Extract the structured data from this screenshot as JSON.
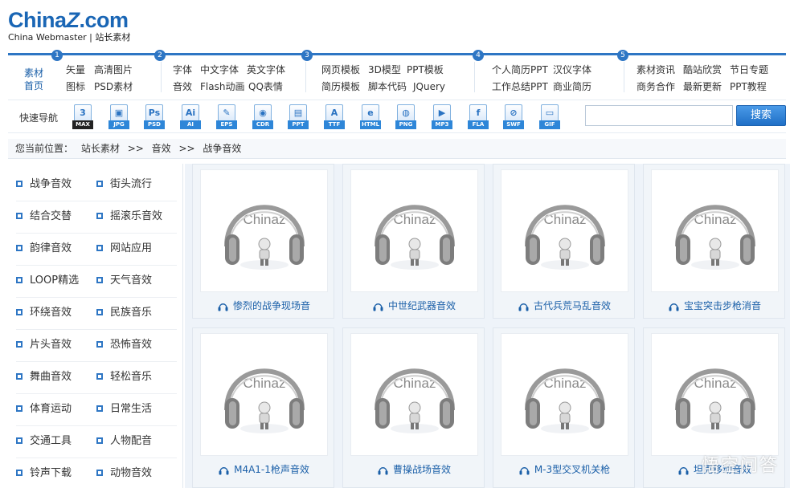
{
  "logo": {
    "main_a": "China",
    "main_z": "Z",
    "main_b": ".com",
    "sub": "China Webmaster | 站长素材"
  },
  "catnav": {
    "home": [
      "素材",
      "首页"
    ],
    "sections": [
      {
        "num": "1",
        "links": [
          "矢量",
          "高清图片",
          "图标",
          "PSD素材"
        ]
      },
      {
        "num": "2",
        "links": [
          "字体",
          "中文字体",
          "英文字体",
          "音效",
          "Flash动画",
          "QQ表情"
        ]
      },
      {
        "num": "3",
        "links": [
          "网页模板",
          "3D模型",
          "PPT模板",
          "简历模板",
          "脚本代码",
          "JQuery"
        ]
      },
      {
        "num": "4",
        "links": [
          "个人简历PPT",
          "汉仪字体",
          "工作总结PPT",
          "商业简历"
        ]
      },
      {
        "num": "5",
        "links": [
          "素材资讯",
          "酷站欣赏",
          "节日专题",
          "商务合作",
          "最新更新",
          "PPT教程"
        ]
      }
    ]
  },
  "quicknav": {
    "label": "快速导航",
    "icons": [
      {
        "glyph": "3",
        "tag": "MAX"
      },
      {
        "glyph": "▣",
        "tag": "JPG"
      },
      {
        "glyph": "Ps",
        "tag": "PSD"
      },
      {
        "glyph": "Ai",
        "tag": "AI"
      },
      {
        "glyph": "✎",
        "tag": "EPS"
      },
      {
        "glyph": "◉",
        "tag": "CDR"
      },
      {
        "glyph": "▤",
        "tag": "PPT"
      },
      {
        "glyph": "A",
        "tag": "TTF"
      },
      {
        "glyph": "e",
        "tag": "HTML"
      },
      {
        "glyph": "◍",
        "tag": "PNG"
      },
      {
        "glyph": "▶",
        "tag": "MP3"
      },
      {
        "glyph": "f",
        "tag": "FLA"
      },
      {
        "glyph": "⊘",
        "tag": "SWF"
      },
      {
        "glyph": "▭",
        "tag": "GIF"
      }
    ],
    "search_placeholder": "",
    "search_button": "搜索"
  },
  "breadcrumb": {
    "prefix": "您当前位置：",
    "items": [
      "站长素材",
      ">>",
      "音效",
      ">>",
      "战争音效"
    ]
  },
  "sidebar": {
    "items": [
      [
        "战争音效",
        "街头流行"
      ],
      [
        "结合交替",
        "摇滚乐音效"
      ],
      [
        "韵律音效",
        "网站应用"
      ],
      [
        "LOOP精选",
        "天气音效"
      ],
      [
        "环绕音效",
        "民族音乐"
      ],
      [
        "片头音效",
        "恐怖音效"
      ],
      [
        "舞曲音效",
        "轻松音乐"
      ],
      [
        "体育运动",
        "日常生活"
      ],
      [
        "交通工具",
        "人物配音"
      ],
      [
        "铃声下载",
        "动物音效"
      ]
    ]
  },
  "cards": [
    {
      "thumb_text": "Chinaz",
      "title": "惨烈的战争现场音"
    },
    {
      "thumb_text": "Chinaz",
      "title": "中世纪武器音效"
    },
    {
      "thumb_text": "Chinaz",
      "title": "古代兵荒马乱音效"
    },
    {
      "thumb_text": "Chinaz",
      "title": "宝宝突击步枪消音"
    },
    {
      "thumb_text": "Chinaz",
      "title": "M4A1-1枪声音效"
    },
    {
      "thumb_text": "Chinaz",
      "title": "曹操战场音效"
    },
    {
      "thumb_text": "Chinaz",
      "title": "M-3型交叉机关枪"
    },
    {
      "thumb_text": "Chinaz",
      "title": "坦克移动音效"
    }
  ],
  "watermark": "悟空问答",
  "colors": {
    "brand": "#1a66b5",
    "accent": "#2e76c4",
    "panel": "#eef3f9"
  }
}
